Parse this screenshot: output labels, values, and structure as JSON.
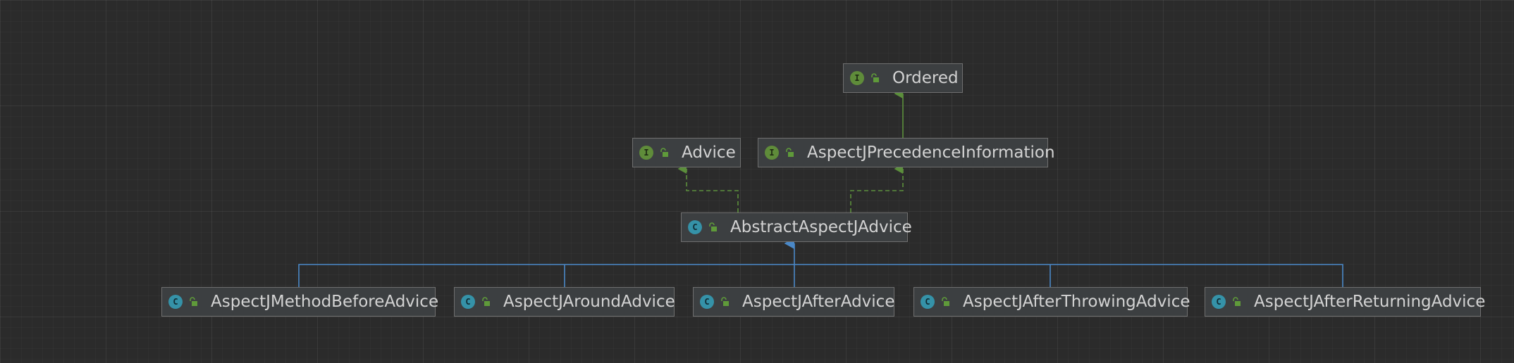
{
  "diagram": {
    "nodes": [
      {
        "id": "ordered",
        "label": "Ordered",
        "kind": "interface",
        "kind_letter": "I",
        "visibility_icon": "unlock-icon"
      },
      {
        "id": "advice",
        "label": "Advice",
        "kind": "interface",
        "kind_letter": "I",
        "visibility_icon": "unlock-icon"
      },
      {
        "id": "aspectj-precedence-information",
        "label": "AspectJPrecedenceInformation",
        "kind": "interface",
        "kind_letter": "I",
        "visibility_icon": "unlock-icon"
      },
      {
        "id": "abstract-aspectj-advice",
        "label": "AbstractAspectJAdvice",
        "kind": "abstract-class",
        "kind_letter": "C",
        "visibility_icon": "unlock-icon"
      },
      {
        "id": "aspectj-method-before-advice",
        "label": "AspectJMethodBeforeAdvice",
        "kind": "class",
        "kind_letter": "C",
        "visibility_icon": "unlock-icon"
      },
      {
        "id": "aspectj-around-advice",
        "label": "AspectJAroundAdvice",
        "kind": "class",
        "kind_letter": "C",
        "visibility_icon": "unlock-icon"
      },
      {
        "id": "aspectj-after-advice",
        "label": "AspectJAfterAdvice",
        "kind": "class",
        "kind_letter": "C",
        "visibility_icon": "unlock-icon"
      },
      {
        "id": "aspectj-after-throwing-advice",
        "label": "AspectJAfterThrowingAdvice",
        "kind": "class",
        "kind_letter": "C",
        "visibility_icon": "unlock-icon"
      },
      {
        "id": "aspectj-after-returning-advice",
        "label": "AspectJAfterReturningAdvice",
        "kind": "class",
        "kind_letter": "C",
        "visibility_icon": "unlock-icon"
      }
    ],
    "edges": [
      {
        "from": "aspectj-precedence-information",
        "to": "ordered",
        "type": "extends"
      },
      {
        "from": "abstract-aspectj-advice",
        "to": "advice",
        "type": "implements"
      },
      {
        "from": "abstract-aspectj-advice",
        "to": "aspectj-precedence-information",
        "type": "implements"
      },
      {
        "from": "aspectj-method-before-advice",
        "to": "abstract-aspectj-advice",
        "type": "extends"
      },
      {
        "from": "aspectj-around-advice",
        "to": "abstract-aspectj-advice",
        "type": "extends"
      },
      {
        "from": "aspectj-after-advice",
        "to": "abstract-aspectj-advice",
        "type": "extends"
      },
      {
        "from": "aspectj-after-throwing-advice",
        "to": "abstract-aspectj-advice",
        "type": "extends"
      },
      {
        "from": "aspectj-after-returning-advice",
        "to": "abstract-aspectj-advice",
        "type": "extends"
      }
    ],
    "colors": {
      "background": "#2b2b2b",
      "node_fill": "#3c3f41",
      "node_border": "#6f6f6f",
      "label": "#d3d3d3",
      "interface_badge": "#5f8c3a",
      "class_badge": "#3592a8",
      "interface_edge": "#5c8f3c",
      "class_edge": "#4a88c7",
      "lock": "#5f9a3a"
    }
  }
}
